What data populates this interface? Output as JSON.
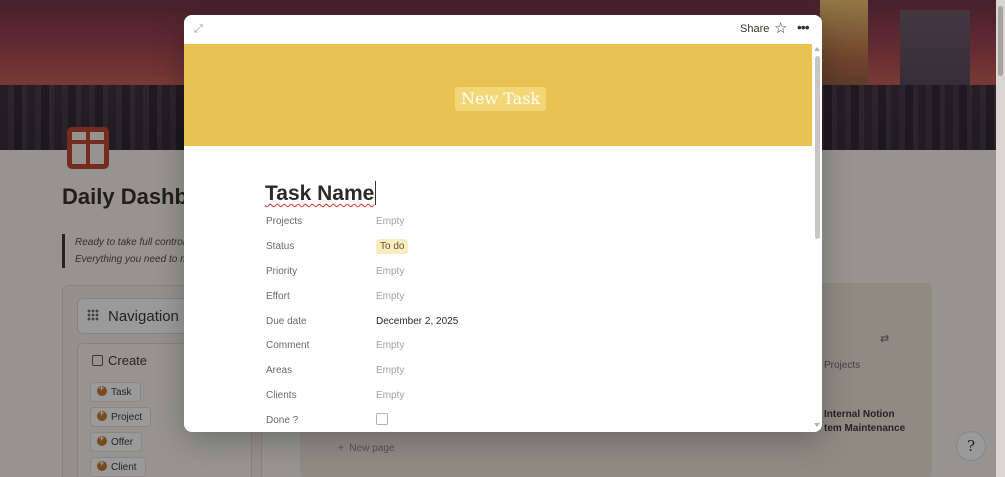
{
  "background": {
    "page_title": "Daily Dashbo",
    "quote_lines": [
      "Ready to take full control o",
      "Everything you need to ma"
    ],
    "navigation_title": "Navigation",
    "create_title": "Create",
    "create_items": [
      "Task",
      "Project",
      "Offer",
      "Client"
    ],
    "new_page": "New page",
    "projects_column": "Projects",
    "row_text": [
      "Internal Notion",
      "tem Maintenance"
    ],
    "help_glyph": "?"
  },
  "modal": {
    "share_label": "Share",
    "star_icon": "star-icon",
    "more_icon": "more-icon",
    "expand_icon": "expand-icon",
    "banner_text": "New Task",
    "banner_color": "#e9c352",
    "title": "Task Name",
    "properties": [
      {
        "label": "Projects",
        "value": "Empty"
      },
      {
        "label": "Status",
        "value": "To do"
      },
      {
        "label": "Priority",
        "value": "Empty"
      },
      {
        "label": "Effort",
        "value": "Empty"
      },
      {
        "label": "Due date",
        "value": "December 2, 2025"
      },
      {
        "label": "Comment",
        "value": "Empty"
      },
      {
        "label": "Areas",
        "value": "Empty"
      },
      {
        "label": "Clients",
        "value": "Empty"
      },
      {
        "label": "Done ?",
        "value": ""
      }
    ]
  }
}
